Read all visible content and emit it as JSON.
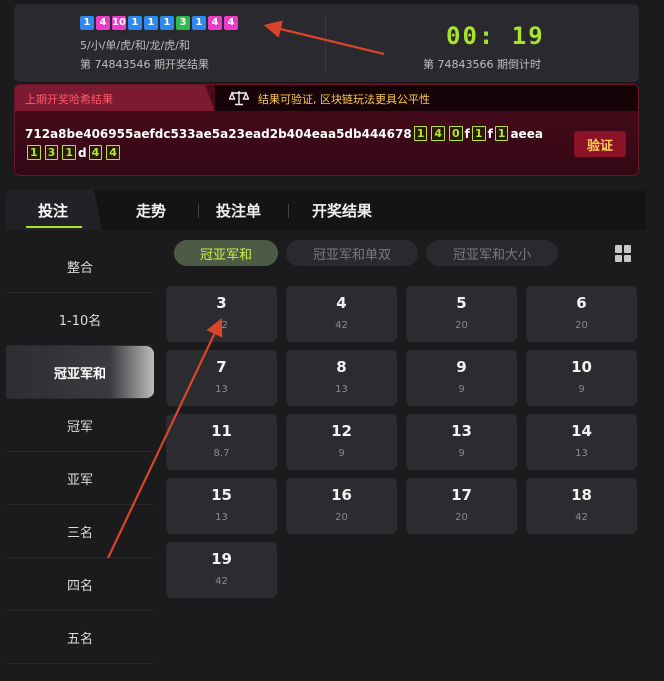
{
  "last_result": {
    "balls": [
      {
        "text": "1",
        "color": "#2f88ee"
      },
      {
        "text": "4",
        "color": "#e93cc9"
      },
      {
        "text": "10",
        "color": "#e93cc9"
      },
      {
        "text": "1",
        "color": "#2f88ee"
      },
      {
        "text": "1",
        "color": "#2f88ee"
      },
      {
        "text": "1",
        "color": "#2f88ee"
      },
      {
        "text": "3",
        "color": "#2fb84d"
      },
      {
        "text": "1",
        "color": "#2f88ee"
      },
      {
        "text": "4",
        "color": "#e93cc9"
      },
      {
        "text": "4",
        "color": "#e93cc9"
      }
    ],
    "summary": "5/小/单/虎/和/龙/虎/和",
    "issue_label": "第 74843546 期开奖结果"
  },
  "countdown": {
    "time": "00: 19",
    "label": "第 74843566 期倒计时"
  },
  "hash": {
    "tab_label": "上期开奖哈希结果",
    "note": "结果可验证, 区块链玩法更具公平性",
    "segments": [
      {
        "t": "712a8be406955aefdc533ae5a23ead2b404eaa5db444678",
        "box": false
      },
      {
        "t": "1",
        "box": true
      },
      {
        "t": "4",
        "box": true
      },
      {
        "t": "0",
        "box": true
      },
      {
        "t": "f",
        "box": false
      },
      {
        "t": "1",
        "box": true
      },
      {
        "t": "f",
        "box": false
      },
      {
        "t": "1",
        "box": true
      },
      {
        "t": "aeea",
        "box": false
      },
      {
        "t": "1",
        "box": true
      },
      {
        "t": "3",
        "box": true
      },
      {
        "t": "1",
        "box": true
      },
      {
        "t": "d",
        "box": false
      },
      {
        "t": "4",
        "box": true
      },
      {
        "t": "4",
        "box": true
      }
    ],
    "verify_button": "验证"
  },
  "main_tabs": [
    "投注",
    "走势",
    "投注单",
    "开奖结果"
  ],
  "sidebar": [
    "整合",
    "1-10名",
    "冠亚军和",
    "冠军",
    "亚军",
    "三名",
    "四名",
    "五名"
  ],
  "sub_tabs": [
    "冠亚军和",
    "冠亚军和单双",
    "冠亚军和大小"
  ],
  "cells": [
    {
      "num": "3",
      "odds": "42"
    },
    {
      "num": "4",
      "odds": "42"
    },
    {
      "num": "5",
      "odds": "20"
    },
    {
      "num": "6",
      "odds": "20"
    },
    {
      "num": "7",
      "odds": "13"
    },
    {
      "num": "8",
      "odds": "13"
    },
    {
      "num": "9",
      "odds": "9"
    },
    {
      "num": "10",
      "odds": "9"
    },
    {
      "num": "11",
      "odds": "8.7"
    },
    {
      "num": "12",
      "odds": "9"
    },
    {
      "num": "13",
      "odds": "9"
    },
    {
      "num": "14",
      "odds": "13"
    },
    {
      "num": "15",
      "odds": "13"
    },
    {
      "num": "16",
      "odds": "20"
    },
    {
      "num": "17",
      "odds": "20"
    },
    {
      "num": "18",
      "odds": "42"
    },
    {
      "num": "19",
      "odds": "42"
    }
  ],
  "colors": {
    "accent": "#a8e52a",
    "annotation_arrow": "#d9442b"
  }
}
